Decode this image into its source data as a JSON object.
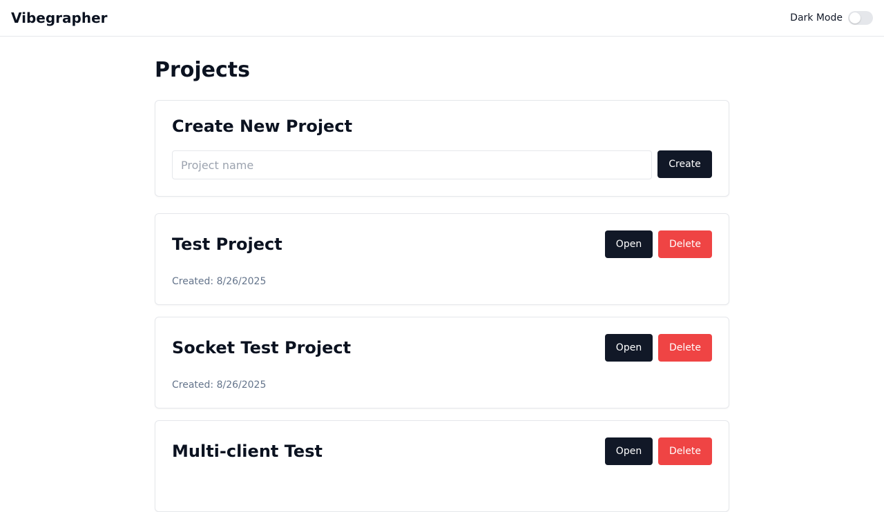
{
  "header": {
    "brand": "Vibegrapher",
    "dark_mode_label": "Dark Mode",
    "dark_mode_on": false
  },
  "page": {
    "title": "Projects"
  },
  "create": {
    "title": "Create New Project",
    "input_placeholder": "Project name",
    "input_value": "",
    "button_label": "Create"
  },
  "projects": [
    {
      "name": "Test Project",
      "created": "Created: 8/26/2025",
      "open_label": "Open",
      "delete_label": "Delete"
    },
    {
      "name": "Socket Test Project",
      "created": "Created: 8/26/2025",
      "open_label": "Open",
      "delete_label": "Delete"
    },
    {
      "name": "Multi-client Test",
      "created": "",
      "open_label": "Open",
      "delete_label": "Delete"
    }
  ],
  "colors": {
    "primary_button": "#111827",
    "danger_button": "#ef4444",
    "border": "#e5e7eb",
    "muted_text": "#64748b"
  }
}
